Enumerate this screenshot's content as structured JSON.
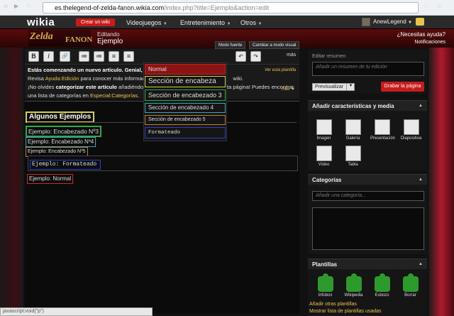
{
  "browser": {
    "url_host": "es.thelegend-of-zelda-fanon.wikia.com",
    "url_path": "/index.php?title=Ejemplo&action=edit",
    "back_icon": "arrow-left-icon",
    "forward_icon": "arrow-right-icon",
    "reload_icon": "reload-icon"
  },
  "wikiabar": {
    "logo": "wikia",
    "create_button": "Crear un wiki",
    "nav": [
      "Videojuegos",
      "Entretenimiento",
      "Otros"
    ],
    "username": "AnewLegend"
  },
  "header": {
    "logo_main": "Zelda",
    "logo_sub": "FANON",
    "editing_label": "Editando",
    "page_title": "Ejemplo",
    "help_link": "¿Necesitas ayuda?",
    "notifications": "Notificaciones",
    "mode_source": "Modo fuente",
    "mode_visual": "Cambiar a modo visual"
  },
  "toolbar": {
    "buttons": [
      "B",
      "I",
      "🔗",
      "≔",
      "≔",
      "≡",
      "≡"
    ],
    "more": "más"
  },
  "notice": {
    "line1_bold": "Estás comenzando un nuevo artículo. Genial, ¿",
    "line2_pre": "Revisa ",
    "line2_link": "AyudaːEdición",
    "line2_post": " para conocer más información",
    "line2_tail": "wiki.",
    "line3_pre": "¡No olvides ",
    "line3_bold": "categorizar este artículo",
    "line3_post": " añadiéndo",
    "line3_tail": "ta página! Puedes encontrar",
    "line4_pre": "una lista de categorías en ",
    "line4_link": "Especial:Categorías.",
    "ver_plantilla": "Ver esta plantilla",
    "mas": "más ▼"
  },
  "editor": {
    "heading2": "Algunos Ejemplos",
    "h3": "Ejemplo: Encabezado Nº3",
    "h4": "Ejemplo: Encabezado Nº4",
    "h5": "Ejemplo: Encabezado Nº5",
    "pre": "Ejemplo: Formateado",
    "normal": "Ejemplo: Normal"
  },
  "format_dropdown": {
    "items": [
      "Normal",
      "Sección de encabeza",
      "Sección de encabezado 3",
      "Sección de encabezado 4",
      "Sección de encabezado 5",
      "Formateado"
    ]
  },
  "rail": {
    "summary_label": "Editar resumen",
    "summary_placeholder": "Añadir un resumen de tu edición",
    "preview_button": "Previsualizar",
    "save_button": "Grabar la página",
    "features_title": "Añadir características y media",
    "media": [
      "Imagen",
      "Galería",
      "Presentación",
      "Diapositiva",
      "Vídeo",
      "Tabla"
    ],
    "categories_title": "Categorías",
    "category_placeholder": "Añadir una categoría...",
    "templates_title": "Plantillas",
    "templates": [
      "Infobox",
      "Wikipedia",
      "Esbozo",
      "Borrar"
    ],
    "add_templates": "Añadir otras plantillas",
    "show_templates": "Mostrar lista de plantillas usadas"
  },
  "status_bar": "javascript:void(\"p\")",
  "colors": {
    "accent_red": "#c81b1b",
    "link_gold": "#e8c24a"
  }
}
